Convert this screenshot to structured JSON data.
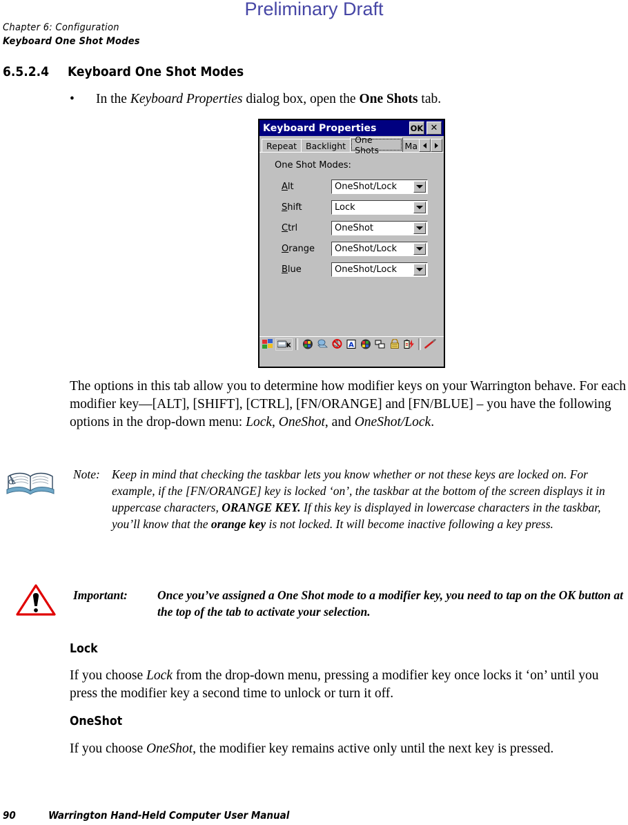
{
  "header": {
    "draft_watermark": "Preliminary Draft",
    "chapter": "Chapter 6:  Configuration",
    "subheader": "Keyboard One Shot Modes"
  },
  "section": {
    "number": "6.5.2.4",
    "title": "Keyboard One Shot Modes"
  },
  "bullet": {
    "marker": "•",
    "text_before": "In the ",
    "italic_1": "Keyboard Properties",
    "text_mid": " dialog box, open the ",
    "bold_1": "One Shots",
    "text_after": " tab."
  },
  "dialog": {
    "title": "Keyboard Properties",
    "ok_label": "OK",
    "close_label": "✕",
    "tabs": [
      {
        "label": "Repeat",
        "selected": false
      },
      {
        "label": "Backlight",
        "selected": false
      },
      {
        "label": "One Shots",
        "selected": true
      },
      {
        "label": "Ma",
        "selected": false
      }
    ],
    "scroll_left": "◄",
    "scroll_right": "►",
    "group_label": "One Shot Modes:",
    "fields": [
      {
        "label": "Alt",
        "accel": "A",
        "label_rest": "lt",
        "value": "OneShot/Lock"
      },
      {
        "label": "Shift",
        "accel": "S",
        "label_rest": "hift",
        "value": "Lock"
      },
      {
        "label": "Ctrl",
        "accel": "C",
        "label_rest": "trl",
        "value": "OneShot"
      },
      {
        "label": "Orange",
        "accel": "O",
        "label_rest": "range",
        "value": "OneShot/Lock"
      },
      {
        "label": "Blue",
        "accel": "B",
        "label_rest": "lue",
        "value": "OneShot/Lock"
      }
    ],
    "taskbar_icons": [
      "windows-start-icon",
      "sip-keyboard-icon",
      "color-palette-icon",
      "hand-pointer-icon",
      "no-volume-icon",
      "letter-a-icon",
      "color-wheel-icon",
      "network-icon",
      "padlock-icon",
      "battery-charging-icon",
      "stylus-pen-icon"
    ]
  },
  "paragraphs": {
    "intro_1": "The options in this tab allow you to determine how modifier keys on your Warrington behave. For each modifier key—[ALT], [SHIFT], [CTRL], [FN/ORANGE] and [FN/BLUE] – you have the following options in the drop-down menu: ",
    "intro_italic_1": "Lock",
    "intro_2": ", ",
    "intro_italic_2": "OneShot",
    "intro_3": ", and ",
    "intro_italic_3": "OneShot/Lock",
    "intro_4": "."
  },
  "note": {
    "label": "Note:",
    "part_1": "Keep in mind that checking the taskbar lets you know whether or not these keys are locked on. For example, if the [FN/ORANGE] key is locked ‘on’, the taskbar at the bottom of the screen displays it in uppercase characters, ",
    "bold_1": "ORANGE KEY.",
    "part_2": " If this key is displayed in lowercase characters in the taskbar, you’ll know that the ",
    "bold_2": "orange key",
    "part_3": " is not locked. It will become inactive following a key press."
  },
  "important": {
    "label": "Important:",
    "text": "Once you’ve assigned a One Shot mode to a modifier key, you need to tap on the OK button at the top of the tab to activate your selection."
  },
  "lock_section": {
    "heading": "Lock",
    "text_1": "If you choose ",
    "italic_1": "Lock",
    "text_2": " from the drop-down menu, pressing a modifier key once locks it ‘on’ until you press the modifier key a second time to unlock or turn it off."
  },
  "oneshot_section": {
    "heading": "OneShot",
    "text_1": "If you choose ",
    "italic_1": "OneShot",
    "text_2": ", the modifier key remains active only until the next key is pressed."
  },
  "footer": {
    "page_number": "90",
    "manual_title": "Warrington Hand-Held Computer User Manual"
  },
  "colors": {
    "draft_purple": "#4646a5",
    "title_bar_navy": "#000080",
    "dialog_face": "#c0c0c0",
    "warning_red": "#e00000"
  }
}
